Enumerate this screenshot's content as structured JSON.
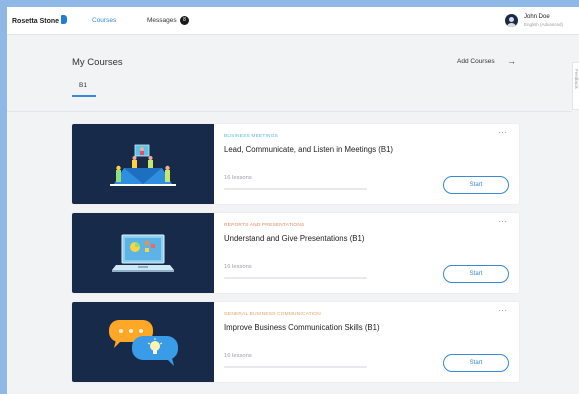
{
  "nav": {
    "logo": "Rosetta Stone",
    "courses": "Courses",
    "messages": "Messages",
    "messages_count": "8",
    "user_name": "John Doe",
    "user_level": "English (Advanced)"
  },
  "header": {
    "title": "My Courses",
    "add_courses": "Add Courses",
    "add_arrow": "→",
    "level_tab": "B1",
    "feedback": "Feedback"
  },
  "colors": {
    "accent": "#3a88d8",
    "thumb_bg": "#182a4a"
  },
  "courses": [
    {
      "category": "BUSINESS MEETINGS",
      "category_color": "#5bb8d8",
      "title": "Lead, Communicate, and Listen in Meetings (B1)",
      "lessons": "16 lessons",
      "progress": 0,
      "start": "Start",
      "more": "···",
      "icon": "meeting-illustration"
    },
    {
      "category": "REPORTS AND PRESENTATIONS",
      "category_color": "#e8836a",
      "title": "Understand and Give Presentations (B1)",
      "lessons": "16 lessons",
      "progress": 0,
      "start": "Start",
      "more": "···",
      "icon": "laptop-chart-illustration"
    },
    {
      "category": "GENERAL BUSINESS COMMUNICATION",
      "category_color": "#e8a060",
      "title": "Improve Business Communication Skills (B1)",
      "lessons": "16 lessons",
      "progress": 0,
      "start": "Start",
      "more": "···",
      "icon": "chat-bubbles-illustration"
    }
  ]
}
